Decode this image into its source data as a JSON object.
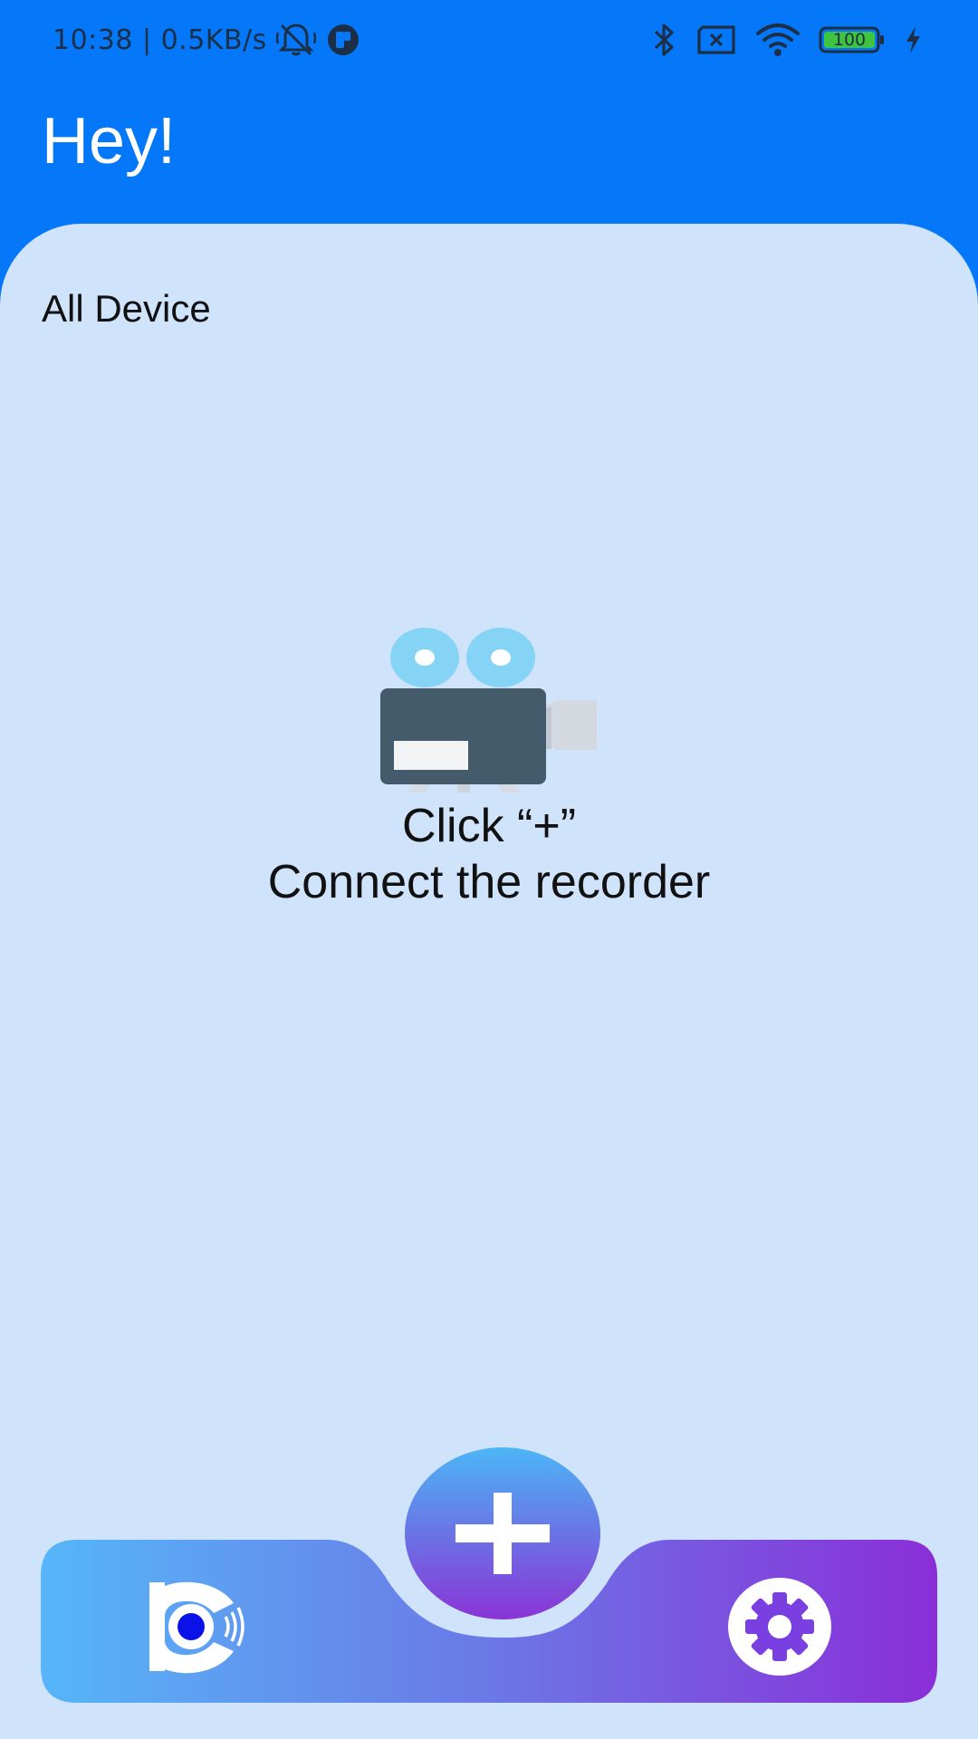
{
  "status_bar": {
    "time": "10:38",
    "separator": "|",
    "network_speed": "0.5KB/s",
    "battery_level": "100",
    "icons": [
      "mute-icon",
      "app-notification-icon",
      "bluetooth-icon",
      "sim-x-icon",
      "wifi-icon",
      "battery-icon",
      "charging-icon"
    ]
  },
  "header": {
    "greeting": "Hey!"
  },
  "main": {
    "section_title": "All Device",
    "empty_state": {
      "line1": "Click “+”",
      "line2": "Connect the recorder",
      "icon": "camera-recorder-icon"
    }
  },
  "bottom_nav": {
    "left_icon": "home-recorder-logo-icon",
    "center_icon": "plus-icon",
    "right_icon": "gear-icon"
  },
  "colors": {
    "header_bg": "#0478f8",
    "content_bg": "#cfe3fb",
    "nav_gradient_start": "#56b6f8",
    "nav_gradient_end": "#8a2ed8",
    "battery_fill": "#3ec43e"
  }
}
